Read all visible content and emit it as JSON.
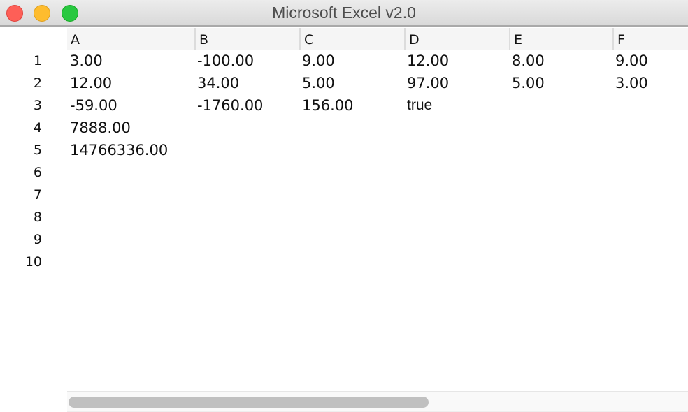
{
  "window": {
    "title": "Microsoft Excel v2.0",
    "controls": {
      "close": "#fe5f57",
      "minimize": "#febc2e",
      "zoom": "#28c840"
    }
  },
  "columns": [
    "A",
    "B",
    "C",
    "D",
    "E",
    "F"
  ],
  "row_numbers": [
    "1",
    "2",
    "3",
    "4",
    "5",
    "6",
    "7",
    "8",
    "9",
    "10"
  ],
  "rows": [
    [
      "3.00",
      "-100.00",
      "9.00",
      "12.00",
      "8.00",
      "9.00"
    ],
    [
      "12.00",
      "34.00",
      "5.00",
      "97.00",
      "5.00",
      "3.00"
    ],
    [
      "-59.00",
      "-1760.00",
      "156.00",
      "true",
      "",
      ""
    ],
    [
      "7888.00",
      "",
      "",
      "",
      "",
      ""
    ],
    [
      "14766336.00",
      "",
      "",
      "",
      "",
      ""
    ]
  ]
}
